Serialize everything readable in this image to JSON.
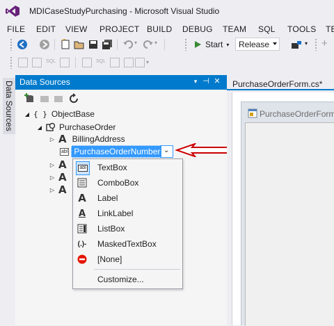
{
  "window": {
    "title": "MDICaseStudyPurchasing - Microsoft Visual Studio"
  },
  "menu": [
    "FILE",
    "EDIT",
    "VIEW",
    "PROJECT",
    "BUILD",
    "DEBUG",
    "TEAM",
    "SQL",
    "TOOLS",
    "TE"
  ],
  "toolbar": {
    "start_label": "Start",
    "configuration": "Release"
  },
  "side_tab": {
    "label": "Data Sources"
  },
  "panel": {
    "title": "Data Sources",
    "header_buttons": [
      "pin-icon",
      "close-icon"
    ],
    "tree": {
      "root": "ObjectBase",
      "object": "PurchaseOrder",
      "fields": [
        "BillingAddress",
        "PurchaseOrderNumber"
      ]
    }
  },
  "dropdown_menu": {
    "items": [
      {
        "label": "TextBox",
        "icon": "textbox-icon"
      },
      {
        "label": "ComboBox",
        "icon": "combobox-icon"
      },
      {
        "label": "Label",
        "icon": "label-icon"
      },
      {
        "label": "LinkLabel",
        "icon": "linklabel-icon"
      },
      {
        "label": "ListBox",
        "icon": "listbox-icon"
      },
      {
        "label": "MaskedTextBox",
        "icon": "maskedtextbox-icon"
      },
      {
        "label": "[None]",
        "icon": "none-icon"
      },
      {
        "label": "Customize...",
        "icon": ""
      }
    ]
  },
  "document": {
    "tab_label": "PurchaseOrderForm.cs*",
    "form_title": "PurchaseOrderForm"
  },
  "colors": {
    "accent": "#007acc",
    "selection": "#3399ff",
    "arrow": "#cc0000"
  }
}
